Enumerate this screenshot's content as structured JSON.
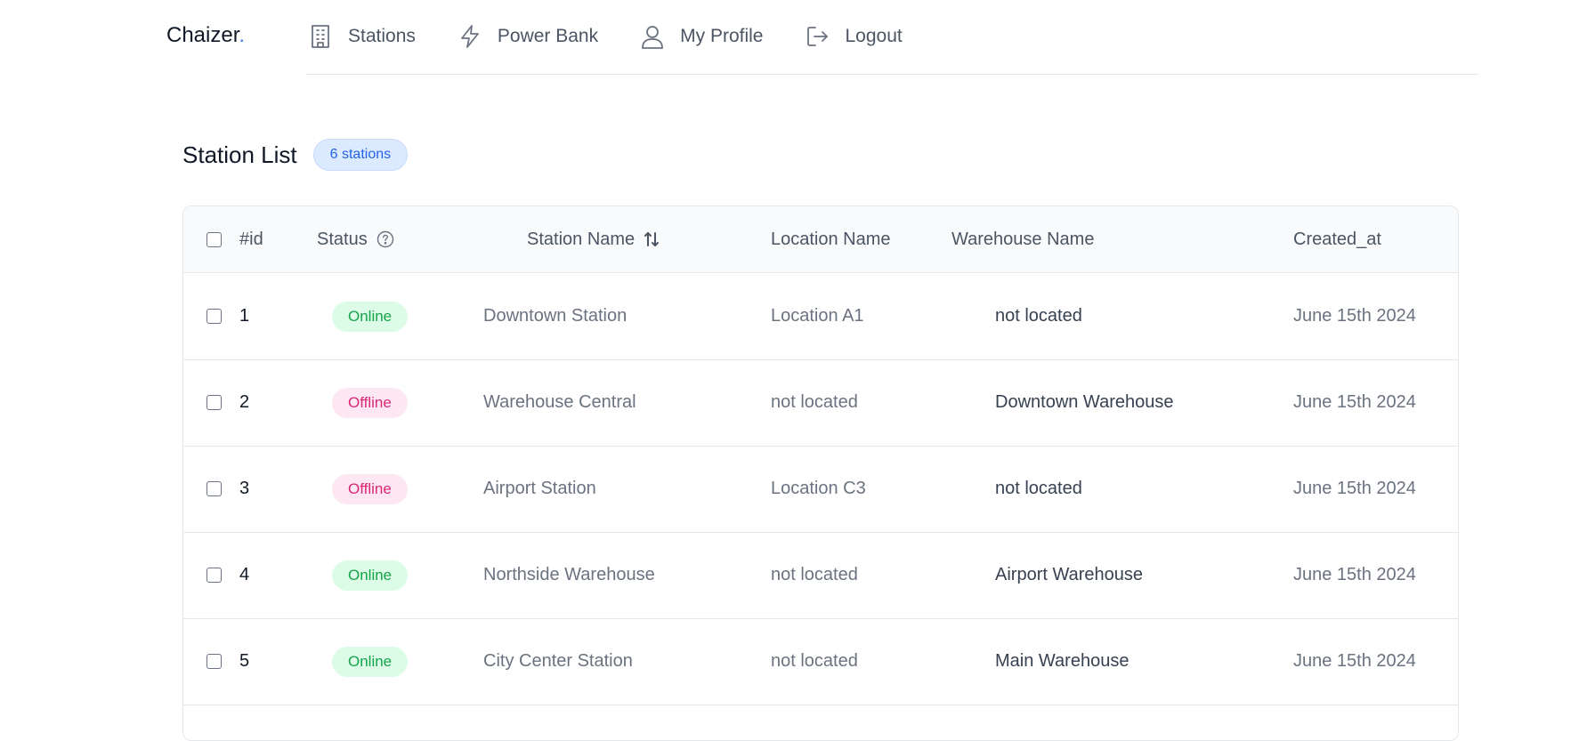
{
  "app": {
    "logo_text": "Chaizer",
    "logo_dot": "."
  },
  "nav": [
    {
      "label": "Stations",
      "icon": "building-icon"
    },
    {
      "label": "Power Bank",
      "icon": "lightning-icon"
    },
    {
      "label": "My Profile",
      "icon": "user-icon"
    },
    {
      "label": "Logout",
      "icon": "logout-icon"
    }
  ],
  "page": {
    "title": "Station List",
    "count_badge": "6 stations"
  },
  "table": {
    "columns": {
      "id": "#id",
      "status": "Status",
      "station_name": "Station Name",
      "location_name": "Location Name",
      "warehouse_name": "Warehouse Name",
      "created_at": "Created_at"
    },
    "rows": [
      {
        "id": "1",
        "status": "Online",
        "station_name": "Downtown Station",
        "location_name": "Location A1",
        "warehouse_name": "not located",
        "created_at": "June 15th 2024"
      },
      {
        "id": "2",
        "status": "Offline",
        "station_name": "Warehouse Central",
        "location_name": "not located",
        "warehouse_name": "Downtown Warehouse",
        "created_at": "June 15th 2024"
      },
      {
        "id": "3",
        "status": "Offline",
        "station_name": "Airport Station",
        "location_name": "Location C3",
        "warehouse_name": "not located",
        "created_at": "June 15th 2024"
      },
      {
        "id": "4",
        "status": "Online",
        "station_name": "Northside Warehouse",
        "location_name": "not located",
        "warehouse_name": "Airport Warehouse",
        "created_at": "June 15th 2024"
      },
      {
        "id": "5",
        "status": "Online",
        "station_name": "City Center Station",
        "location_name": "not located",
        "warehouse_name": "Main Warehouse",
        "created_at": "June 15th 2024"
      }
    ]
  },
  "colors": {
    "online_bg": "#dcfce7",
    "online_text": "#16a34a",
    "offline_bg": "#fce7f3",
    "offline_text": "#db2777",
    "badge_bg": "#dbeafe",
    "badge_text": "#2563eb"
  }
}
